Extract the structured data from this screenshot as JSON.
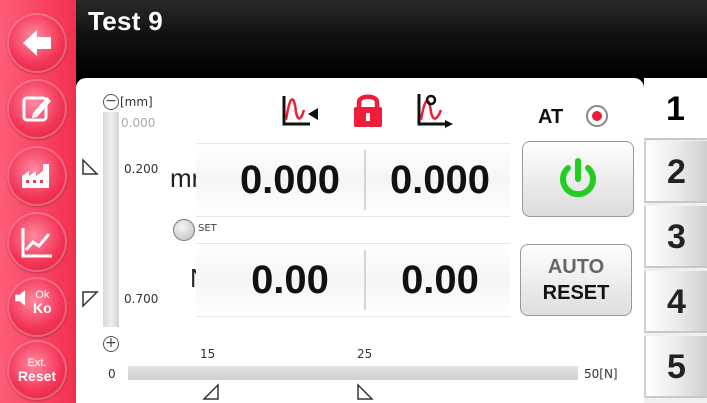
{
  "header": {
    "title": "Test 9"
  },
  "sidebar": {
    "items": [
      {
        "name": "back",
        "icon": "arrow-left-icon"
      },
      {
        "name": "edit",
        "icon": "edit-icon"
      },
      {
        "name": "factory",
        "icon": "factory-icon"
      },
      {
        "name": "graph",
        "icon": "line-chart-icon"
      },
      {
        "name": "ok-ko",
        "icon": "speaker-icon",
        "label_top": "Ok",
        "label_bottom": "Ko"
      },
      {
        "name": "ext-reset",
        "label_top": "Ext.",
        "label_bottom": "Reset"
      }
    ]
  },
  "vertical_scale": {
    "unit": "[mm]",
    "top_value": "0.000",
    "upper_limit": "0.200",
    "lower_limit": "0.700",
    "minus_symbol": "−",
    "plus_symbol": "+"
  },
  "horizontal_scale": {
    "start": "0",
    "marker1": "15",
    "marker2": "25",
    "end": "50[N]"
  },
  "toolbar": {
    "icons": [
      "curve-left-icon",
      "lock-icon",
      "curve-right-icon"
    ]
  },
  "readouts": {
    "distance_unit": "mm",
    "distance_value_1": "0.000",
    "distance_value_2": "0.000",
    "force_unit": "N",
    "force_value_1": "0.00",
    "force_value_2": "0.00"
  },
  "set_button": {
    "label": "SET"
  },
  "at_indicator": {
    "label": "AT",
    "led_color": "#ee1d3a"
  },
  "power_button": {
    "icon": "power-icon",
    "color": "#22cc22"
  },
  "reset_button": {
    "label_line1": "AUTO",
    "label_line2": "RESET"
  },
  "tabs": [
    "1",
    "2",
    "3",
    "4",
    "5"
  ],
  "colors": {
    "accent": "#f2304f",
    "lock": "#ee1d3a"
  }
}
